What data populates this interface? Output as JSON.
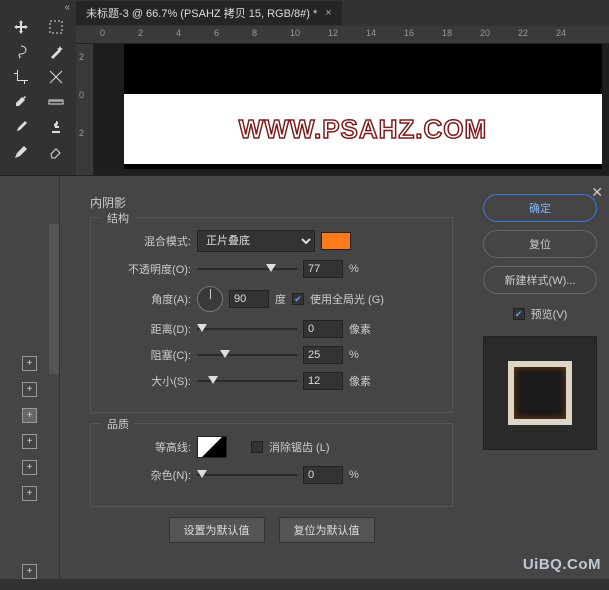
{
  "tab": {
    "title": "未标题-3 @ 66.7% (PSAHZ 拷贝 15, RGB/8#) *"
  },
  "ruler_h": [
    "0",
    "2",
    "4",
    "6",
    "8",
    "10",
    "12",
    "14",
    "16",
    "18",
    "20",
    "22",
    "24"
  ],
  "ruler_v": [
    "2",
    "0",
    "2"
  ],
  "canvas": {
    "watermark": "WWW.PSAHZ.COM"
  },
  "dialog": {
    "title": "内阴影",
    "structure_label": "结构",
    "quality_label": "品质",
    "blend_mode": {
      "label": "混合模式:",
      "value": "正片叠底",
      "swatch": "#ff7a1a"
    },
    "opacity": {
      "label": "不透明度(O):",
      "value": "77",
      "unit": "%",
      "pct": 77
    },
    "angle": {
      "label": "角度(A):",
      "value": "90",
      "unit": "度",
      "global_label": "使用全局光 (G)",
      "global_checked": true
    },
    "distance": {
      "label": "距离(D):",
      "value": "0",
      "unit": "像素",
      "pct": 0
    },
    "choke": {
      "label": "阻塞(C):",
      "value": "25",
      "unit": "%",
      "pct": 25
    },
    "size": {
      "label": "大小(S):",
      "value": "12",
      "unit": "像素",
      "pct": 12
    },
    "contour": {
      "label": "等高线:",
      "antialias_label": "消除锯齿 (L)",
      "antialias_checked": false
    },
    "noise": {
      "label": "杂色(N):",
      "value": "0",
      "unit": "%",
      "pct": 0
    },
    "buttons": {
      "set_default": "设置为默认值",
      "reset_default": "复位为默认值"
    }
  },
  "right": {
    "ok": "确定",
    "reset": "复位",
    "new_style": "新建样式(W)...",
    "preview": "预览(V)",
    "preview_checked": true
  },
  "brand": "UiBQ.CoM"
}
